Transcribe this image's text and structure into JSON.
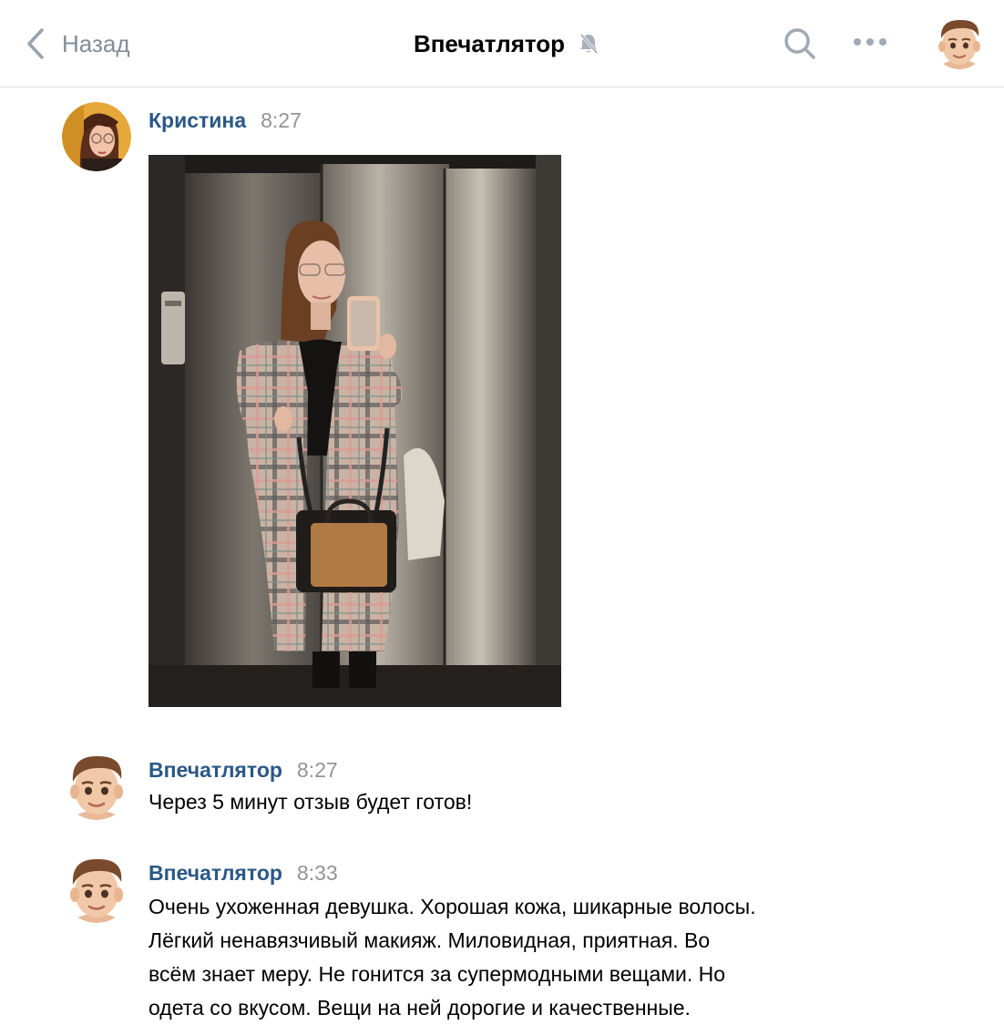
{
  "header": {
    "back_label": "Назад",
    "title": "Впечатлятор",
    "icons": [
      "chevron-left-icon",
      "mute-icon",
      "search-icon",
      "more-icon",
      "avatar"
    ]
  },
  "colors": {
    "link": "#2a5885",
    "secondary": "#818c99",
    "time": "#939393",
    "divider": "#dcdfe4"
  },
  "messages": [
    {
      "author": "Кристина",
      "time": "8:27",
      "attachment": "photo"
    },
    {
      "author": "Впечатлятор",
      "time": "8:27",
      "text": "Через 5 минут отзыв будет готов!"
    },
    {
      "author": "Впечатлятор",
      "time": "8:33",
      "lines": [
        "Очень ухоженная девушка. Хорошая кожа, шикарные волосы.",
        "Лёгкий ненавязчивый макияж. Миловидная, приятная. Во",
        "всём знает меру. Не гонится за супермодными вещами. Но",
        "одета со вкусом. Вещи на ней дорогие и качественные."
      ]
    }
  ]
}
